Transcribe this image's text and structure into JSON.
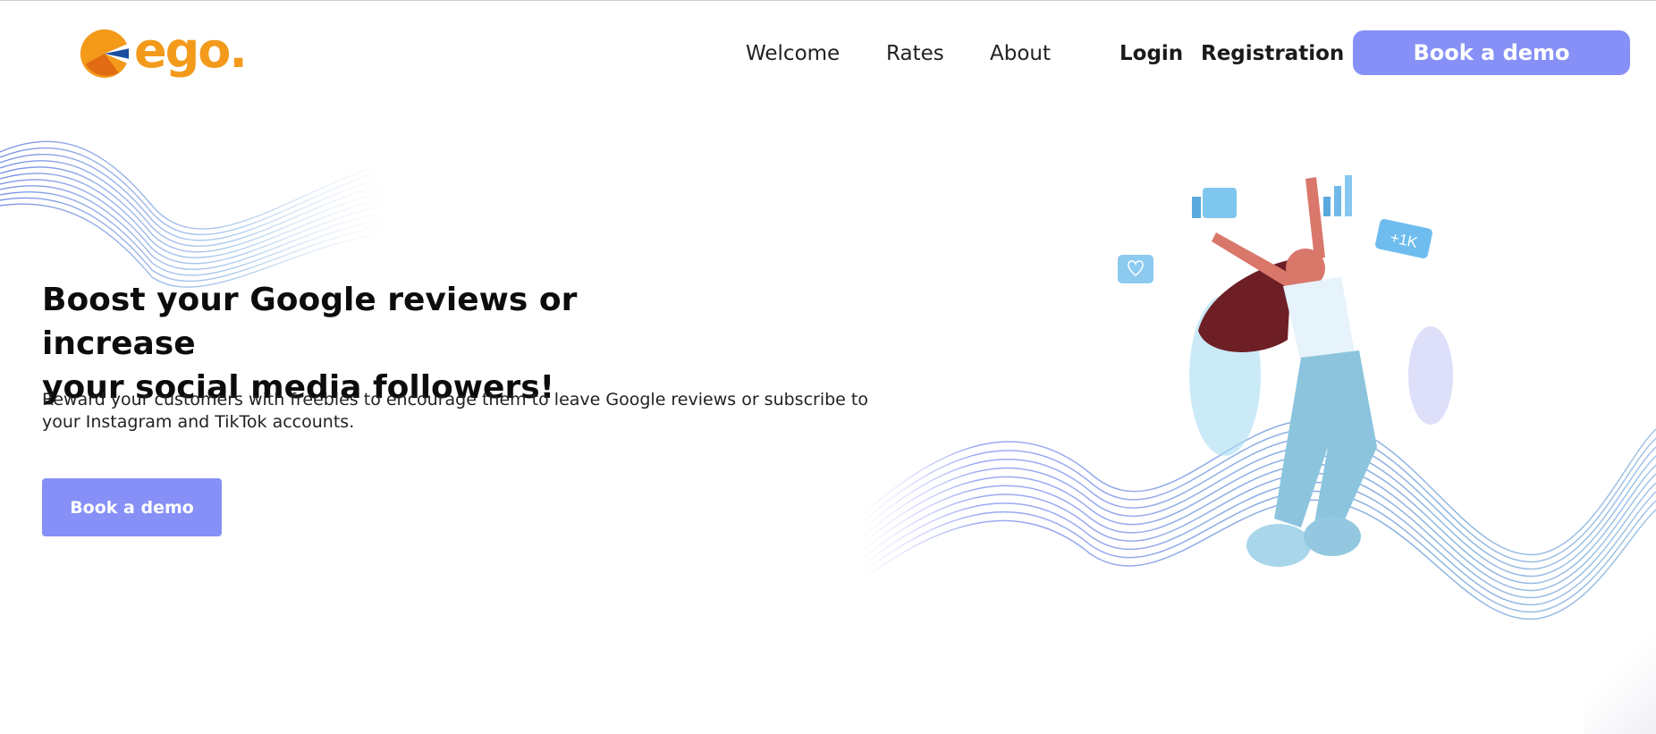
{
  "header": {
    "logo_text": "ego.",
    "nav": {
      "welcome": "Welcome",
      "rates": "Rates",
      "about": "About",
      "login": "Login",
      "registration": "Registration",
      "book_demo": "Book a demo"
    }
  },
  "hero": {
    "title_line1": "Boost your Google reviews or increase",
    "title_line2": "your social media followers!",
    "subtitle_line1": "Reward your customers with freebies to encourage them to leave Google reviews or subscribe to",
    "subtitle_line2": "your Instagram and TikTok accounts.",
    "cta": "Book a demo"
  },
  "illustration": {
    "badge_text": "+1K"
  },
  "colors": {
    "brand_orange": "#f39a1b",
    "accent_purple": "#8690f6",
    "wave_blue": "#7ba7e0"
  }
}
